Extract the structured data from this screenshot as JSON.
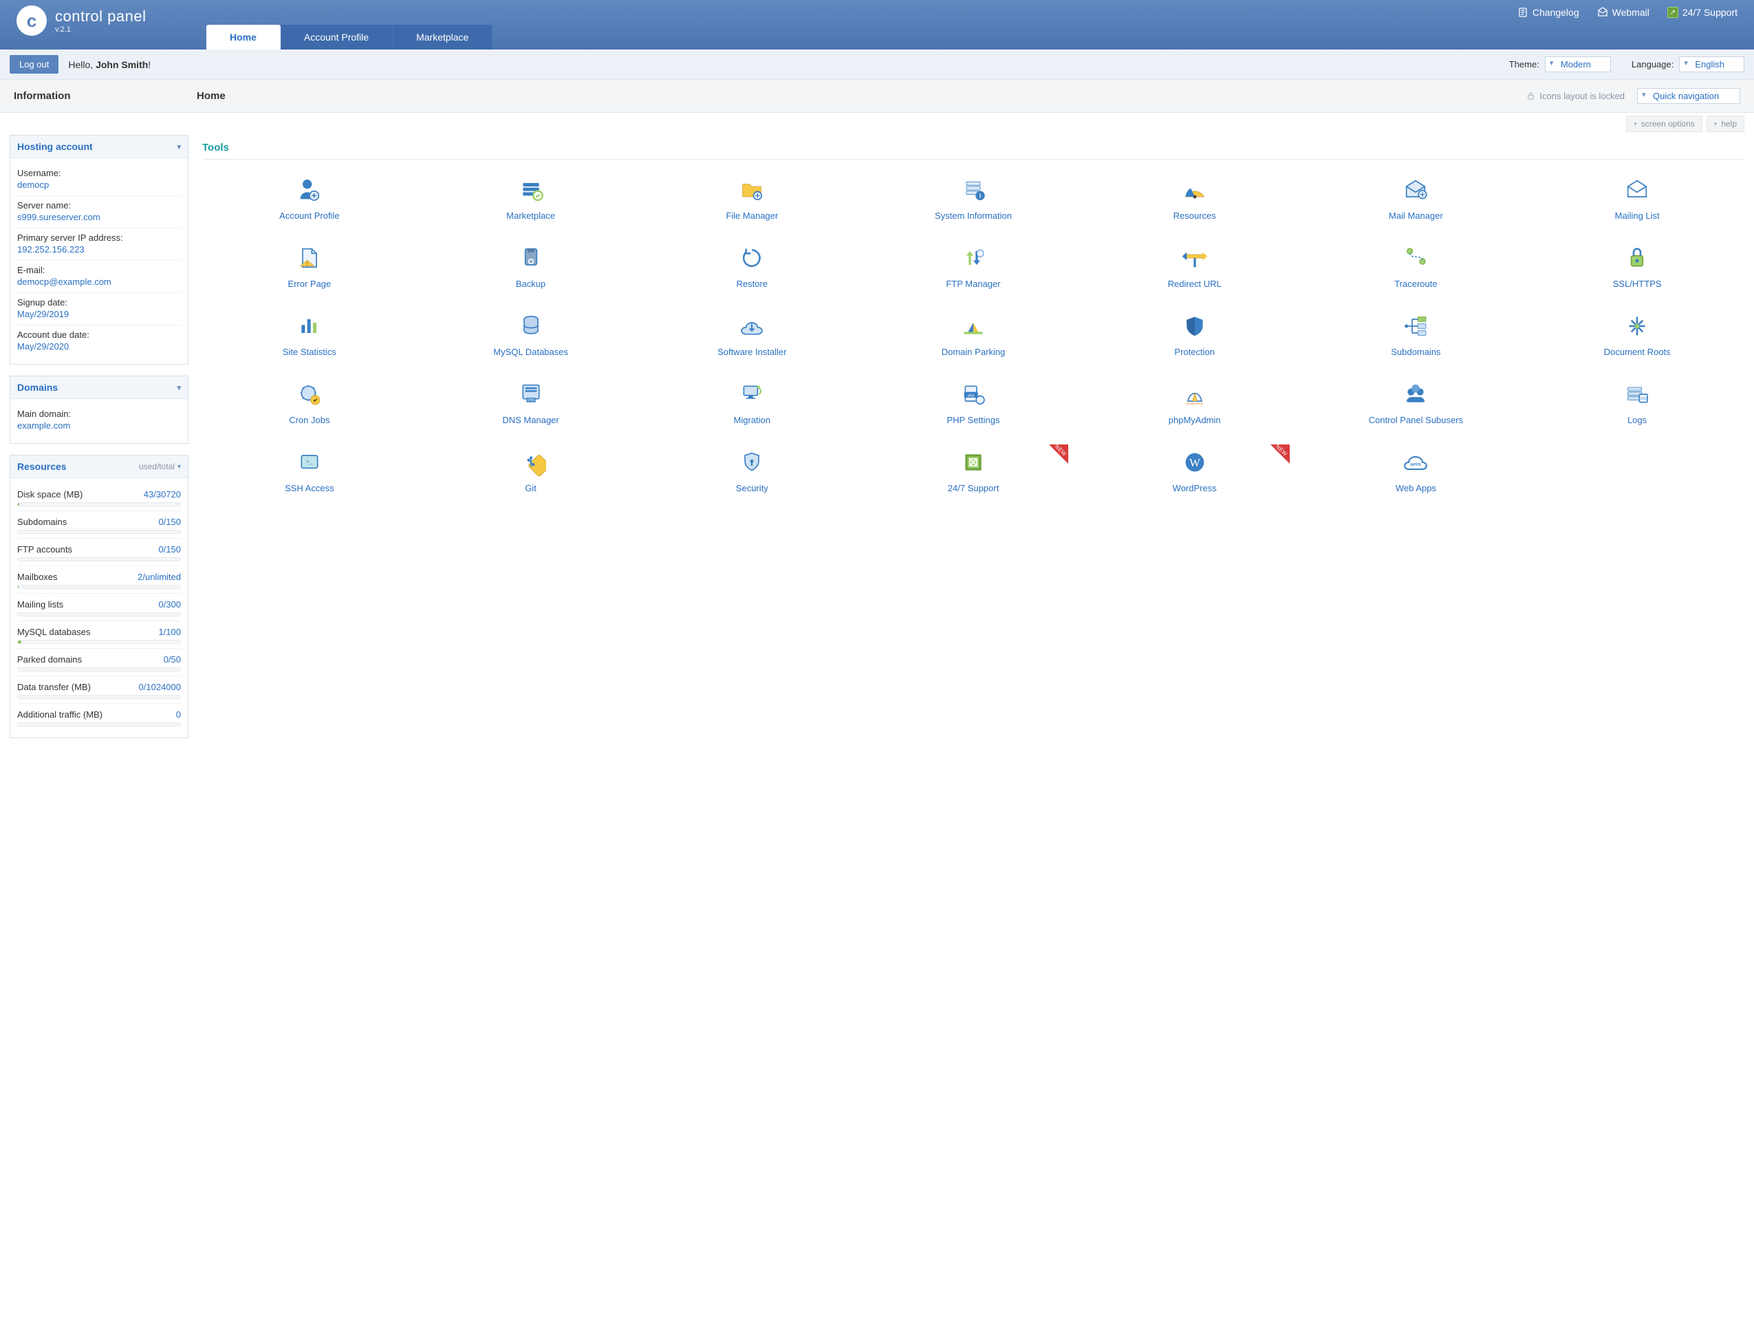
{
  "brand": {
    "name": "control panel",
    "version": "v.2.1",
    "logo_letter": "c"
  },
  "toplinks": {
    "changelog": "Changelog",
    "webmail": "Webmail",
    "support": "24/7 Support"
  },
  "tabs": {
    "home": "Home",
    "account": "Account Profile",
    "marketplace": "Marketplace"
  },
  "subbar": {
    "logout": "Log out",
    "hello_prefix": "Hello, ",
    "hello_name": "John Smith",
    "hello_suffix": "!",
    "theme_label": "Theme:",
    "theme_value": "Modern",
    "lang_label": "Language:",
    "lang_value": "English"
  },
  "section": {
    "sidebar_title": "Information",
    "page_title": "Home",
    "lock_text": "Icons layout is locked",
    "quicknav": "Quick navigation"
  },
  "chips": {
    "screen": "screen options",
    "help": "help"
  },
  "hosting": {
    "title": "Hosting account",
    "username_k": "Username:",
    "username_v": "democp",
    "server_k": "Server name:",
    "server_v": "s999.sureserver.com",
    "ip_k": "Primary server IP address:",
    "ip_v": "192.252.156.223",
    "email_k": "E-mail:",
    "email_v": "democp@example.com",
    "signup_k": "Signup date:",
    "signup_v": "May/29/2019",
    "due_k": "Account due date:",
    "due_v": "May/29/2020"
  },
  "domains": {
    "title": "Domains",
    "main_k": "Main domain:",
    "main_v": "example.com"
  },
  "resources": {
    "title": "Resources",
    "subtitle": "used/total",
    "rows": [
      {
        "k": "Disk space (MB)",
        "v": "43/30720",
        "pct": 1
      },
      {
        "k": "Subdomains",
        "v": "0/150",
        "pct": 0
      },
      {
        "k": "FTP accounts",
        "v": "0/150",
        "pct": 0
      },
      {
        "k": "Mailboxes",
        "v": "2/unlimited",
        "pct": 0.5
      },
      {
        "k": "Mailing lists",
        "v": "0/300",
        "pct": 0
      },
      {
        "k": "MySQL databases",
        "v": "1/100",
        "pct": 2
      },
      {
        "k": "Parked domains",
        "v": "0/50",
        "pct": 0
      },
      {
        "k": "Data transfer (MB)",
        "v": "0/1024000",
        "pct": 0
      },
      {
        "k": "Additional traffic (MB)",
        "v": "0",
        "pct": 0
      }
    ]
  },
  "tools_heading": "Tools",
  "tools": [
    {
      "id": "account-profile",
      "label": "Account Profile"
    },
    {
      "id": "marketplace",
      "label": "Marketplace"
    },
    {
      "id": "file-manager",
      "label": "File Manager"
    },
    {
      "id": "system-information",
      "label": "System Information"
    },
    {
      "id": "resources",
      "label": "Resources"
    },
    {
      "id": "mail-manager",
      "label": "Mail Manager"
    },
    {
      "id": "mailing-list",
      "label": "Mailing List"
    },
    {
      "id": "error-page",
      "label": "Error Page"
    },
    {
      "id": "backup",
      "label": "Backup"
    },
    {
      "id": "restore",
      "label": "Restore"
    },
    {
      "id": "ftp-manager",
      "label": "FTP Manager"
    },
    {
      "id": "redirect-url",
      "label": "Redirect URL"
    },
    {
      "id": "traceroute",
      "label": "Traceroute"
    },
    {
      "id": "ssl-https",
      "label": "SSL/HTTPS"
    },
    {
      "id": "site-statistics",
      "label": "Site Statistics"
    },
    {
      "id": "mysql-databases",
      "label": "MySQL Databases"
    },
    {
      "id": "software-installer",
      "label": "Software Installer"
    },
    {
      "id": "domain-parking",
      "label": "Domain Parking"
    },
    {
      "id": "protection",
      "label": "Protection"
    },
    {
      "id": "subdomains",
      "label": "Subdomains"
    },
    {
      "id": "document-roots",
      "label": "Document Roots"
    },
    {
      "id": "cron-jobs",
      "label": "Cron Jobs"
    },
    {
      "id": "dns-manager",
      "label": "DNS Manager"
    },
    {
      "id": "migration",
      "label": "Migration"
    },
    {
      "id": "php-settings",
      "label": "PHP Settings"
    },
    {
      "id": "phpmyadmin",
      "label": "phpMyAdmin"
    },
    {
      "id": "control-panel-subusers",
      "label": "Control Panel Subusers"
    },
    {
      "id": "logs",
      "label": "Logs"
    },
    {
      "id": "ssh-access",
      "label": "SSH Access"
    },
    {
      "id": "git",
      "label": "Git"
    },
    {
      "id": "security",
      "label": "Security"
    },
    {
      "id": "support",
      "label": "24/7 Support",
      "new": true
    },
    {
      "id": "wordpress",
      "label": "WordPress",
      "new": true
    },
    {
      "id": "web-apps",
      "label": "Web Apps"
    }
  ]
}
